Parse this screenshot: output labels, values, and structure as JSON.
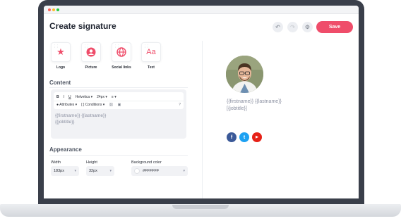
{
  "header": {
    "title": "Create signature",
    "save_label": "Save"
  },
  "blocks": [
    {
      "label": "Logo",
      "icon": "star-icon"
    },
    {
      "label": "Picture",
      "icon": "user-icon"
    },
    {
      "label": "Social links",
      "icon": "globe-icon"
    },
    {
      "label": "Text",
      "icon": "text-icon",
      "glyph": "Aa"
    }
  ],
  "content": {
    "section_label": "Content",
    "toolbar": {
      "bold": "B",
      "italic": "I",
      "underline": "U",
      "font": "Helvetica",
      "size": "24px",
      "attributes": "Attributes",
      "conditions": "[ ] Conditions"
    },
    "editor_lines": [
      "{{firstname}} {{lastname}}",
      "{{jobtitle}}"
    ]
  },
  "appearance": {
    "section_label": "Appearance",
    "width_label": "Width",
    "width_value": "183px",
    "height_label": "Height",
    "height_value": "32px",
    "bg_label": "Background color",
    "bg_value": "#FFFFFF"
  },
  "preview": {
    "name_line": "{{firstname}} {{lastname}}",
    "job_line": "[{jobtitle}]",
    "socials": [
      {
        "name": "facebook-icon",
        "color": "#3b5998",
        "glyph": "f"
      },
      {
        "name": "twitter-icon",
        "color": "#1da1f2",
        "glyph": "t"
      },
      {
        "name": "youtube-icon",
        "color": "#e62117",
        "glyph": "▶"
      }
    ]
  },
  "colors": {
    "accent": "#ef4d6a",
    "laptop_frame": "#3a3f4a"
  }
}
